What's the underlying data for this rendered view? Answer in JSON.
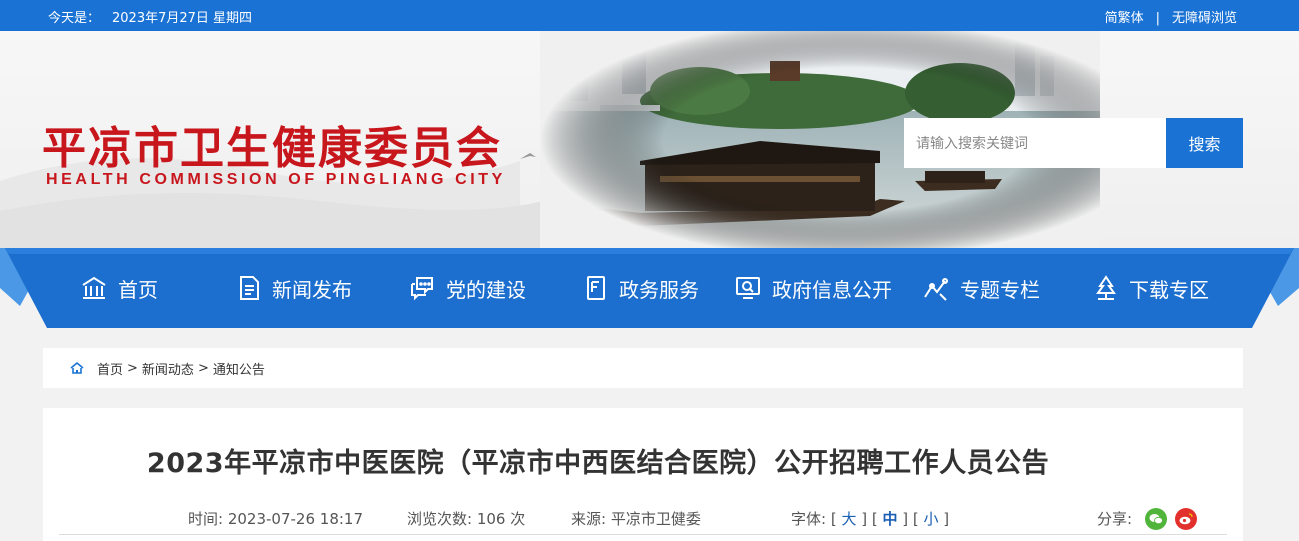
{
  "topbar": {
    "date_label": "今天是：",
    "date_value": "2023年7月27日 星期四",
    "simp_trad": "简繁体",
    "separator": "|",
    "accessibility": "无障碍浏览"
  },
  "header": {
    "title": "平凉市卫生健康委员会",
    "subtitle": "HEALTH COMMISSION OF PINGLIANG CITY",
    "search_placeholder": "请输入搜索关键词",
    "search_button": "搜索"
  },
  "nav": {
    "items": [
      {
        "label": "首页",
        "icon": "home-icon"
      },
      {
        "label": "新闻发布",
        "icon": "document-icon"
      },
      {
        "label": "党的建设",
        "icon": "chat-icon"
      },
      {
        "label": "政务服务",
        "icon": "book-icon"
      },
      {
        "label": "政府信息公开",
        "icon": "monitor-icon"
      },
      {
        "label": "专题专栏",
        "icon": "chart-icon"
      },
      {
        "label": "下载专区",
        "icon": "tree-icon"
      }
    ]
  },
  "breadcrumb": {
    "items": [
      "首页",
      "新闻动态",
      "通知公告"
    ],
    "separator": ">"
  },
  "article": {
    "title": "2023年平凉市中医医院（平凉市中西医结合医院）公开招聘工作人员公告",
    "time_label": "时间:",
    "time_value": "2023-07-26 18:17",
    "views_label": "浏览次数:",
    "views_value": "106 次",
    "source_label": "来源:",
    "source_value": "平凉市卫健委",
    "font_label": "字体:",
    "font_large": "大",
    "font_medium": "中",
    "font_small": "小",
    "share_label": "分享:"
  },
  "colors": {
    "brand_blue": "#1a73d4",
    "title_red": "#c8161d",
    "wechat_green": "#51b53b",
    "weibo_red": "#e2312d"
  }
}
